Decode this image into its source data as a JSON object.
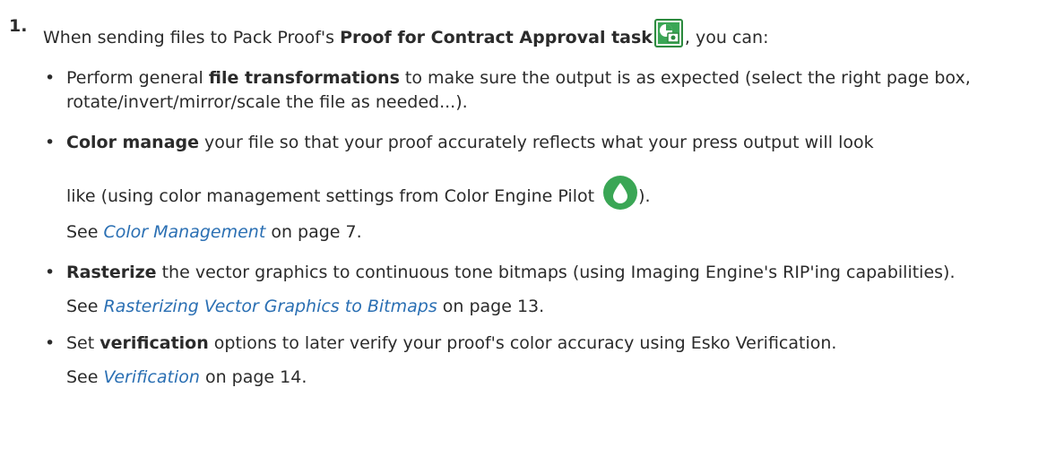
{
  "step": {
    "number": "1."
  },
  "intro": {
    "text_before": "When sending files to Pack Proof's ",
    "task_name": "Proof for Contract Approval task",
    "text_after": ", you can:",
    "task_icon": "proof-task-icon"
  },
  "bullets": [
    {
      "bold": "file transformations",
      "before": "Perform general ",
      "after": " to make sure the output is as expected (select the right page box, rotate/invert/mirror/scale the file as needed...)."
    },
    {
      "bold": "Color manage",
      "line1_after": " your file so that your proof accurately reflects what your press output will look",
      "line2": "like (using color management settings from Color Engine Pilot ",
      "line2_end": ").",
      "icon": "color-engine-pilot-icon",
      "see_prefix": "See ",
      "see_link": "Color Management",
      "see_suffix": " on page 7."
    },
    {
      "bold": "Rasterize",
      "after": " the vector graphics to continuous tone bitmaps (using Imaging Engine's RIP'ing capabilities).",
      "see_prefix": "See ",
      "see_link": "Rasterizing Vector Graphics to Bitmaps",
      "see_suffix": " on page 13."
    },
    {
      "before": "Set ",
      "bold": "verification",
      "after": " options to later verify your proof's color accuracy using Esko Verification.",
      "see_prefix": "See ",
      "see_link": "Verification",
      "see_suffix": " on page 14."
    }
  ],
  "bullet_glyph": "•",
  "colors": {
    "text": "#2b2b2b",
    "link": "#2a6fb3",
    "icon_green": "#3aa655",
    "icon_border": "#2c8a3e"
  }
}
